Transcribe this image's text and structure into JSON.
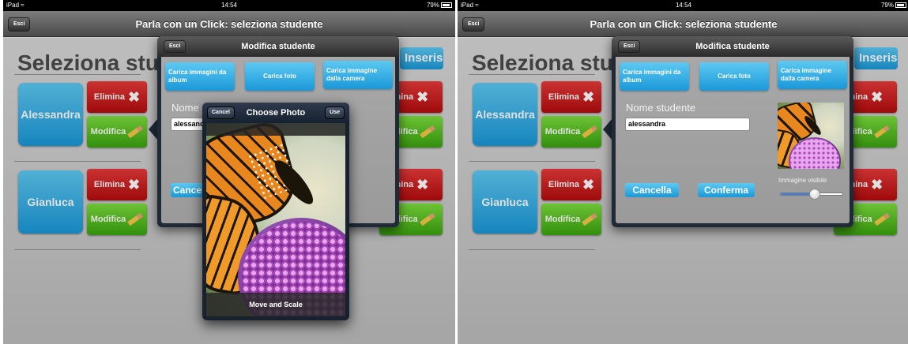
{
  "status": {
    "carrier": "iPad",
    "time": "14:54",
    "battery": "79%"
  },
  "nav": {
    "title": "Parla con un Click: seleziona studente",
    "exit_label": "Esci"
  },
  "page_title": "Seleziona stud",
  "inserisci_label": "Inserisci",
  "students": [
    {
      "name": "Alessandra",
      "delete_label": "Elimina",
      "edit_label": "Modifica"
    },
    {
      "name": "Gianluca",
      "delete_label": "Elimina",
      "edit_label": "Modifica"
    }
  ],
  "right_col": {
    "delete_label": "Elimina",
    "edit_label": "Modifica"
  },
  "modal": {
    "title": "Modifica studente",
    "exit_label": "Esci",
    "album_button": "Carica immagini da album",
    "photo_button": "Carica foto",
    "camera_button": "Carica immagine dalla camera",
    "name_label": "Nome studente",
    "name_value": "alessandra",
    "cancel_label": "Cancella",
    "confirm_label": "Conferma",
    "visible_label": "Immagine visibile",
    "slider_value": 0.55
  },
  "chooser": {
    "title": "Choose Photo",
    "cancel_label": "Cancel",
    "use_label": "Use",
    "footer": "Move and Scale"
  },
  "icons": {
    "delete": "x-icon",
    "edit": "pencil-icon",
    "wifi": "wifi-icon",
    "battery": "battery-icon"
  }
}
